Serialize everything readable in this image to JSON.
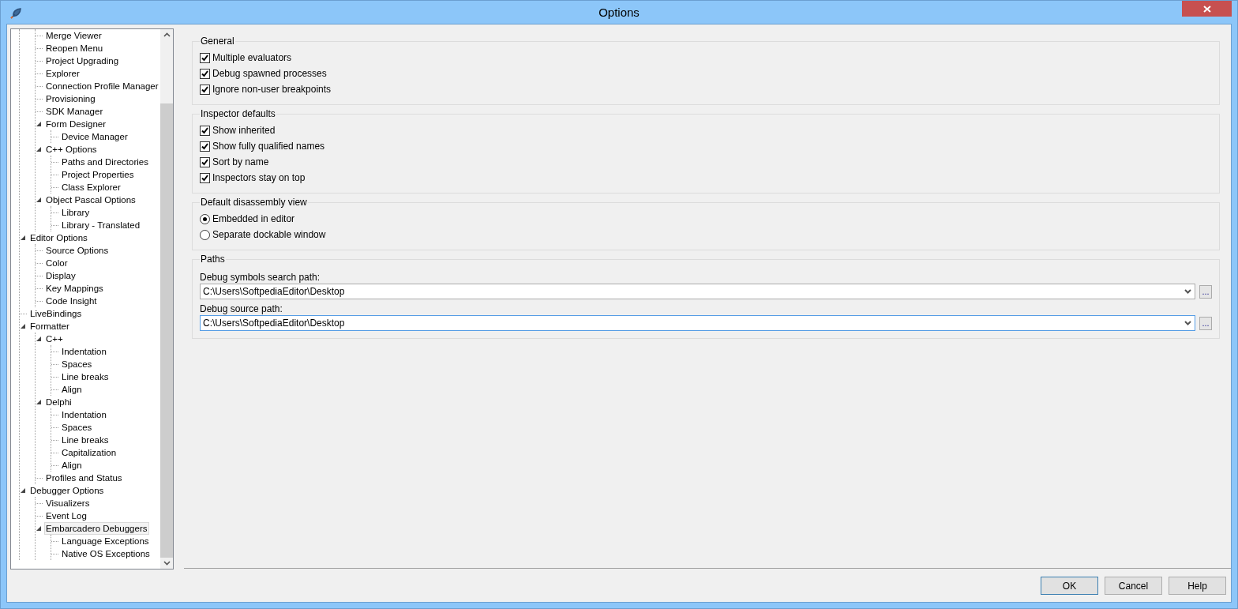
{
  "window": {
    "title": "Options"
  },
  "tree": [
    {
      "children": [
        {
          "label": "Merge Viewer",
          "selected": false
        },
        {
          "label": "Reopen Menu",
          "selected": false
        },
        {
          "label": "Project Upgrading",
          "selected": false
        },
        {
          "label": "Explorer",
          "selected": false
        },
        {
          "label": "Connection Profile Manager",
          "selected": false
        },
        {
          "label": "Provisioning",
          "selected": false
        },
        {
          "label": "SDK Manager",
          "selected": false
        },
        {
          "label": "Form Designer",
          "selected": false,
          "expanded": true,
          "children": [
            {
              "label": "Device Manager",
              "selected": false
            }
          ]
        },
        {
          "label": "C++ Options",
          "selected": false,
          "expanded": true,
          "children": [
            {
              "label": "Paths and Directories",
              "selected": false
            },
            {
              "label": "Project Properties",
              "selected": false
            },
            {
              "label": "Class Explorer",
              "selected": false
            }
          ]
        },
        {
          "label": "Object Pascal Options",
          "selected": false,
          "expanded": true,
          "children": [
            {
              "label": "Library",
              "selected": false
            },
            {
              "label": "Library - Translated",
              "selected": false
            }
          ]
        }
      ]
    },
    {
      "label": "Editor Options",
      "selected": false,
      "expanded": true,
      "children": [
        {
          "label": "Source Options",
          "selected": false
        },
        {
          "label": "Color",
          "selected": false
        },
        {
          "label": "Display",
          "selected": false
        },
        {
          "label": "Key Mappings",
          "selected": false
        },
        {
          "label": "Code Insight",
          "selected": false
        }
      ]
    },
    {
      "label": "LiveBindings",
      "selected": false
    },
    {
      "label": "Formatter",
      "selected": false,
      "expanded": true,
      "children": [
        {
          "label": "C++",
          "selected": false,
          "expanded": true,
          "children": [
            {
              "label": "Indentation",
              "selected": false
            },
            {
              "label": "Spaces",
              "selected": false
            },
            {
              "label": "Line breaks",
              "selected": false
            },
            {
              "label": "Align",
              "selected": false
            }
          ]
        },
        {
          "label": "Delphi",
          "selected": false,
          "expanded": true,
          "children": [
            {
              "label": "Indentation",
              "selected": false
            },
            {
              "label": "Spaces",
              "selected": false
            },
            {
              "label": "Line breaks",
              "selected": false
            },
            {
              "label": "Capitalization",
              "selected": false
            },
            {
              "label": "Align",
              "selected": false
            }
          ]
        },
        {
          "label": "Profiles and Status",
          "selected": false
        }
      ]
    },
    {
      "label": "Debugger Options",
      "selected": false,
      "expanded": true,
      "children": [
        {
          "label": "Visualizers",
          "selected": false
        },
        {
          "label": "Event Log",
          "selected": false
        },
        {
          "label": "Embarcadero Debuggers",
          "selected": true,
          "expanded": true,
          "children": [
            {
              "label": "Language Exceptions",
              "selected": false
            },
            {
              "label": "Native OS Exceptions",
              "selected": false
            }
          ]
        }
      ]
    }
  ],
  "groups": [
    {
      "title": "General",
      "items": [
        {
          "kind": "checkbox",
          "label": "Multiple evaluators",
          "checked": true
        },
        {
          "kind": "checkbox",
          "label": "Debug spawned processes",
          "checked": true
        },
        {
          "kind": "checkbox",
          "label": "Ignore non-user breakpoints",
          "checked": true
        }
      ]
    },
    {
      "title": "Inspector defaults",
      "items": [
        {
          "kind": "checkbox",
          "label": "Show inherited",
          "checked": true
        },
        {
          "kind": "checkbox",
          "label": "Show fully qualified names",
          "checked": true
        },
        {
          "kind": "checkbox",
          "label": "Sort by name",
          "checked": true
        },
        {
          "kind": "checkbox",
          "label": "Inspectors stay on top",
          "checked": true
        }
      ]
    },
    {
      "title": "Default disassembly view",
      "items": [
        {
          "kind": "radio",
          "label": "Embedded in editor",
          "selected": true
        },
        {
          "kind": "radio",
          "label": "Separate dockable window",
          "selected": false
        }
      ]
    },
    {
      "title": "Paths",
      "items": [
        {
          "kind": "path",
          "label": "Debug symbols search path:",
          "value": "C:\\Users\\SoftpediaEditor\\Desktop",
          "focused": false,
          "browse": "..."
        },
        {
          "kind": "path",
          "label": "Debug source path:",
          "value": "C:\\Users\\SoftpediaEditor\\Desktop",
          "focused": true,
          "browse": "..."
        }
      ]
    }
  ],
  "buttons": [
    {
      "label": "OK",
      "default": true
    },
    {
      "label": "Cancel",
      "default": false
    },
    {
      "label": "Help",
      "default": false
    }
  ]
}
